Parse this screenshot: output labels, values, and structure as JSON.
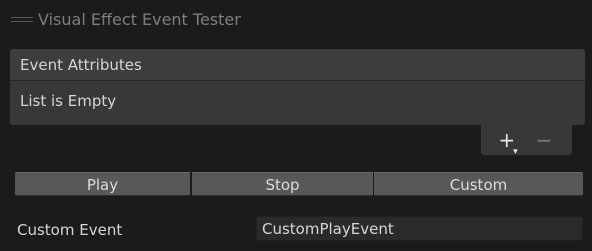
{
  "window": {
    "title": "Visual Effect Event Tester"
  },
  "attributes_list": {
    "header": "Event Attributes",
    "empty_text": "List is Empty",
    "add_label": "+",
    "remove_label": "−"
  },
  "buttons": {
    "play": "Play",
    "stop": "Stop",
    "custom": "Custom"
  },
  "custom_event": {
    "label": "Custom Event",
    "value": "CustomPlayEvent"
  },
  "colors": {
    "panel_background": "#1b1b1b",
    "list_background": "#383838",
    "button_background": "#585858",
    "field_background": "#2a2a2a"
  }
}
